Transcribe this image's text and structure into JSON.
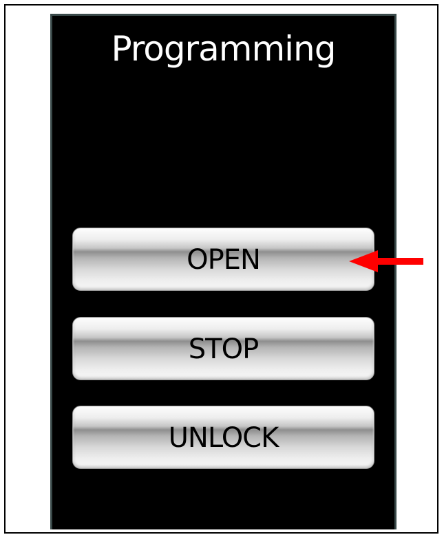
{
  "screen": {
    "title": "Programming"
  },
  "buttons": {
    "open_label": "OPEN",
    "stop_label": "STOP",
    "unlock_label": "UNLOCK"
  },
  "annotation": {
    "arrow_color": "#ff0000",
    "arrow_target": "open-button"
  },
  "colors": {
    "screen_background": "#000000",
    "title_text": "#ffffff",
    "button_text": "#000000",
    "screen_border": "#3a4a4a"
  }
}
